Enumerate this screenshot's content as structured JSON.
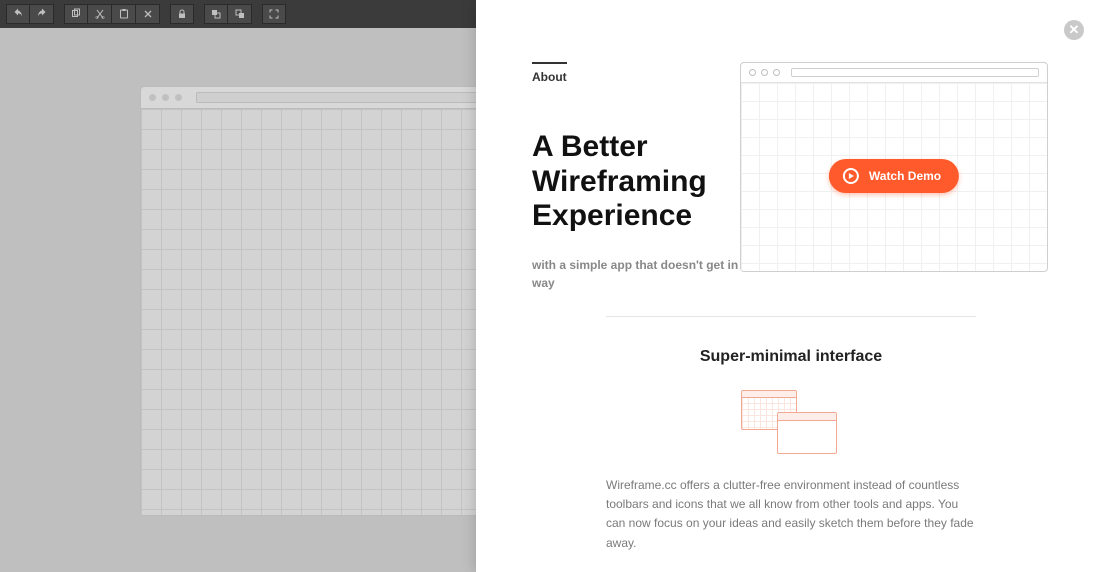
{
  "toolbar": {
    "groups": [
      [
        "undo-icon",
        "redo-icon"
      ],
      [
        "copy-icon",
        "cut-icon",
        "paste-icon",
        "delete-icon"
      ],
      [
        "lock-icon"
      ],
      [
        "to-back-icon",
        "to-front-icon"
      ],
      [
        "fullscreen-icon"
      ]
    ]
  },
  "panel": {
    "about_label": "About",
    "hero_title": "A Better Wireframing Experience",
    "hero_sub": "with a simple app that doesn't get in your way",
    "demo_label": "Watch Demo",
    "feature_title": "Super-minimal interface",
    "feature_body": "Wireframe.cc offers a clutter-free environment instead of countless toolbars and icons that we all know from other tools and apps. You can now focus on your ideas and easily sketch them before they fade away."
  }
}
